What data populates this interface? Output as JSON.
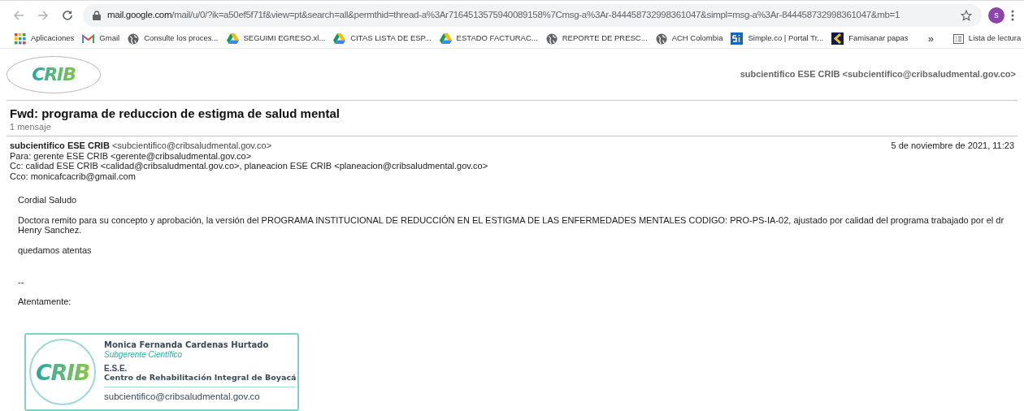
{
  "browser": {
    "url_host": "mail.google.com",
    "url_path": "/mail/u/0/?ik=a50ef5f71f&view=pt&search=all&permthid=thread-a%3Ar7164513575940089158%7Cmsg-a%3Ar-844458732998361047&simpl=msg-a%3Ar-844458732998361047&mb=1",
    "profile_initial": "s"
  },
  "bookmarks": [
    {
      "kind": "apps",
      "label": "Aplicaciones"
    },
    {
      "kind": "gmail",
      "label": "Gmail"
    },
    {
      "kind": "globe",
      "label": "Consulte los proces..."
    },
    {
      "kind": "drive",
      "label": "SEGUIMI EGRESO.xl..."
    },
    {
      "kind": "drive",
      "label": "CITAS LISTA DE ESP..."
    },
    {
      "kind": "drive",
      "label": "ESTADO FACTURAC..."
    },
    {
      "kind": "globe",
      "label": "REPORTE DE PRESC..."
    },
    {
      "kind": "globe",
      "label": "ACH Colombia"
    },
    {
      "kind": "simple",
      "label": "Simple.co | Portal Tr..."
    },
    {
      "kind": "famisanar",
      "label": "Famisanar papas"
    }
  ],
  "bookmarks_more": "»",
  "reading_list": "Lista de lectura",
  "mail": {
    "logo": "CRIB",
    "account": "subcientifico ESE CRIB <subcientifico@cribsaludmental.gov.co>",
    "subject": "Fwd: programa de reduccion de estigma de salud mental",
    "count": "1 mensaje",
    "sender_name": "subcientifico ESE CRIB",
    "sender_email": "<subcientifico@cribsaludmental.gov.co>",
    "date": "5 de noviembre de 2021, 11:23",
    "recipients": [
      "Para: gerente ESE CRIB <gerente@cribsaludmental.gov.co>",
      "Cc: calidad ESE CRIB <calidad@cribsaludmental.gov.co>, planeacion ESE CRIB <planeacion@cribsaludmental.gov.co>",
      "Cco: monicafcacrib@gmail.com"
    ],
    "body": [
      "Cordial Saludo",
      "Doctora remito para su concepto y aprobación, la versión del PROGRAMA INSTITUCIONAL DE REDUCCIÓN EN EL ESTIGMA DE LAS ENFERMEDADES MENTALES CODIGO: PRO-PS-IA-02, ajustado por calidad del programa trabajado por el dr Henry Sanchez.",
      "quedamos atentas"
    ],
    "separator": "--",
    "closing": "Atentamente:",
    "signature": {
      "logo": "CRIB",
      "name": "Monica Fernanda Cardenas Hurtado",
      "role": "Subgerente Científico",
      "org_short": "E.S.E.",
      "org": "Centro de Rehabilitación Integral de Boyacá",
      "email": "subcientifico@cribsaludmental.gov.co"
    }
  }
}
